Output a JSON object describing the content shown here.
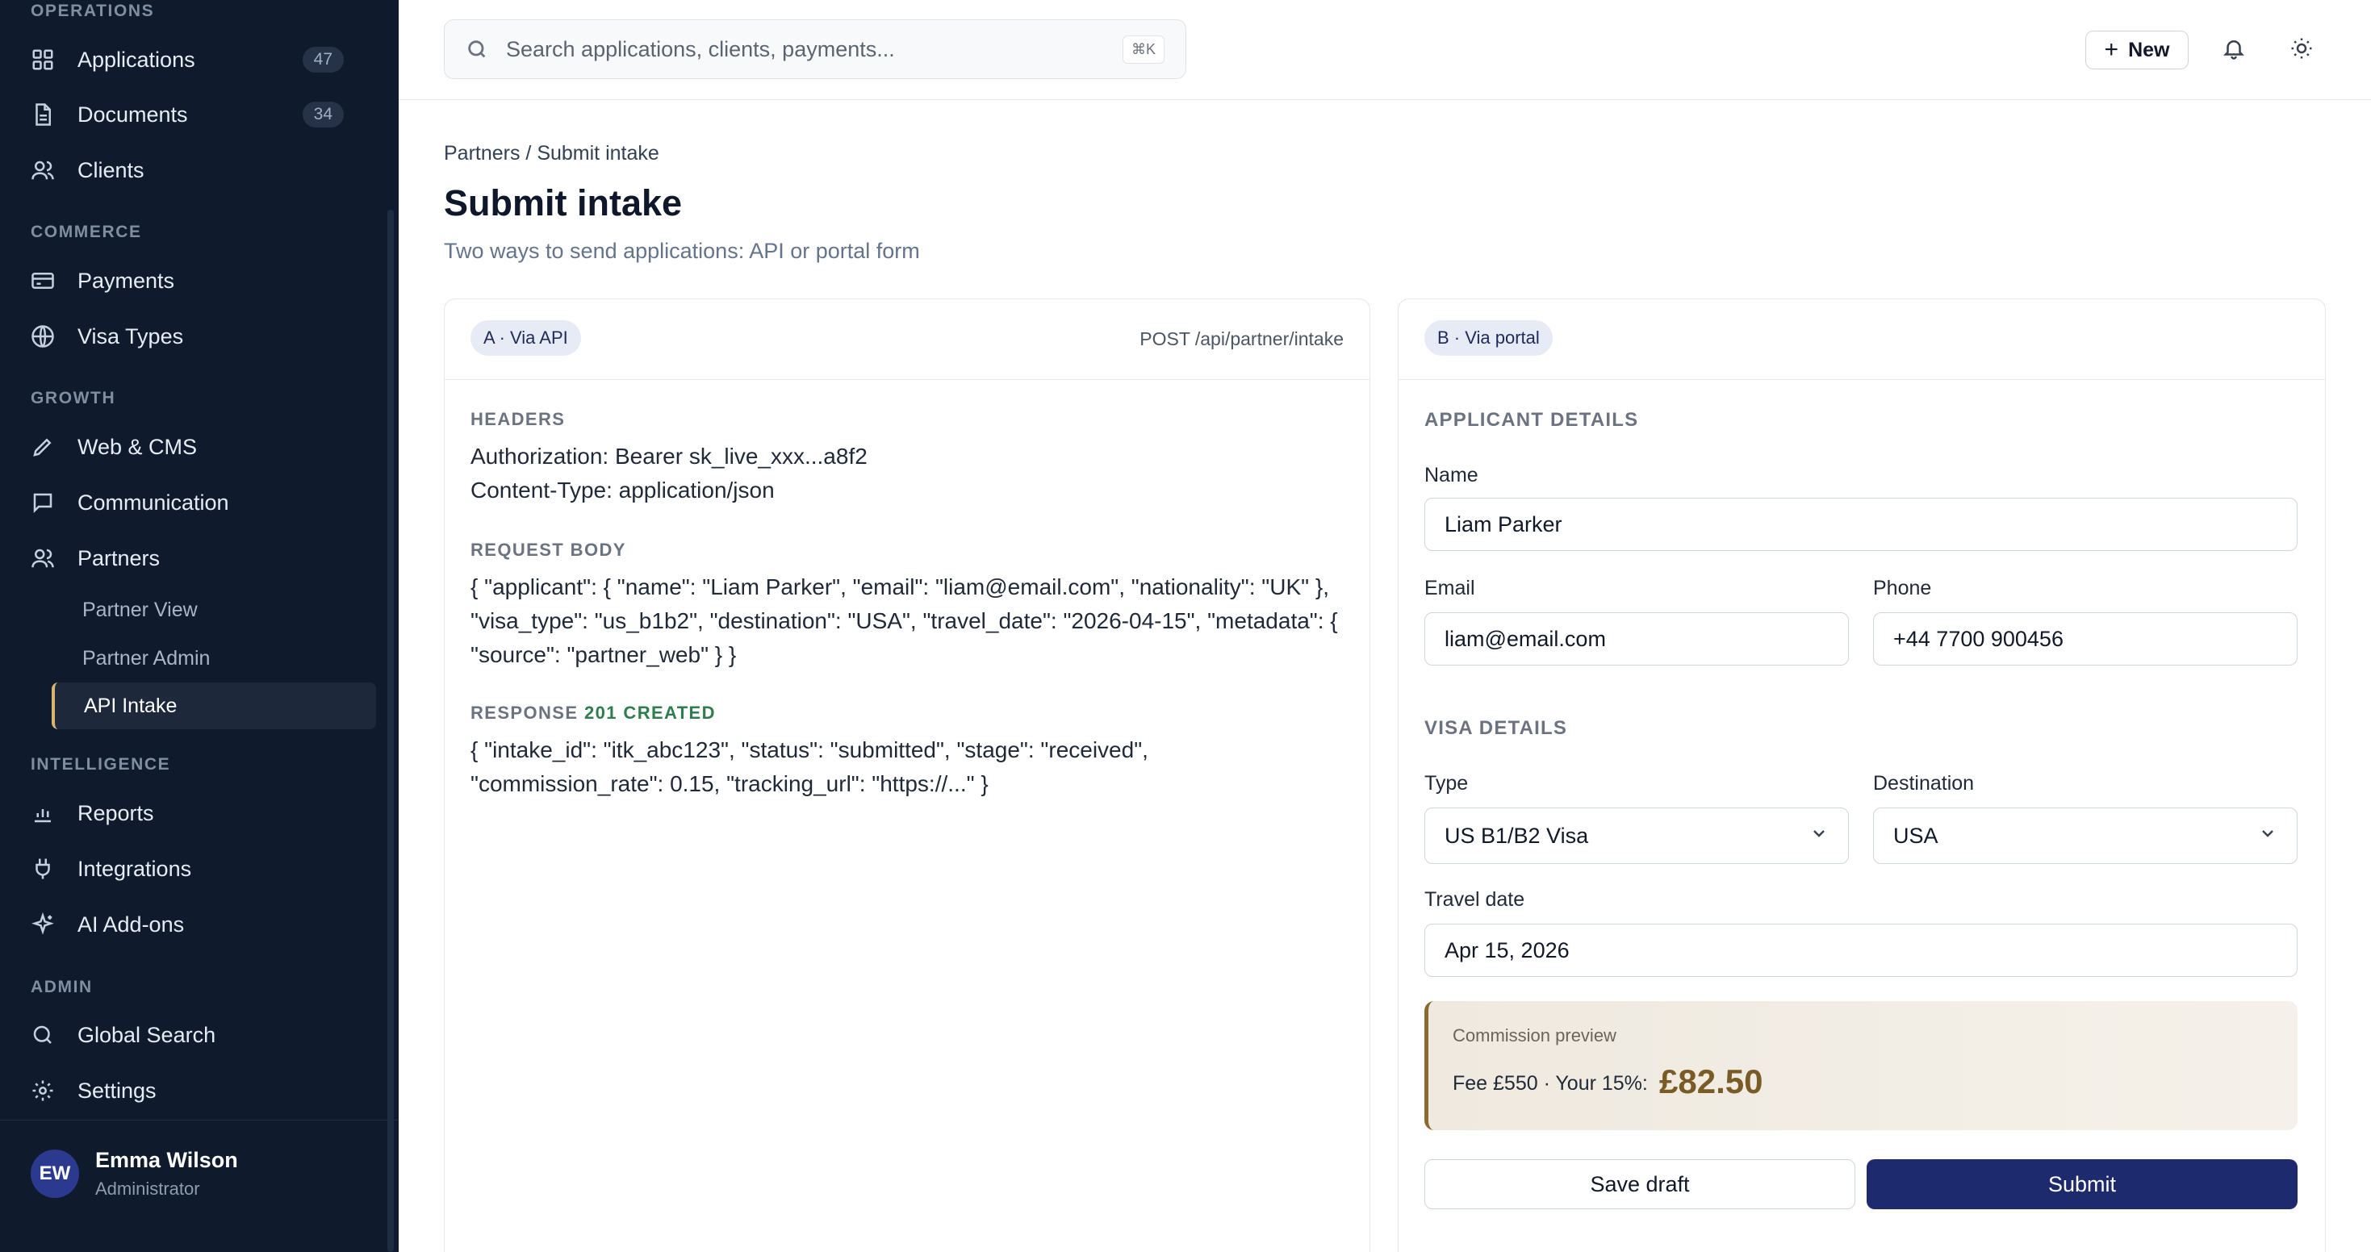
{
  "sidebar": {
    "sections": {
      "operations": "OPERATIONS",
      "commerce": "COMMERCE",
      "growth": "GROWTH",
      "intelligence": "INTELLIGENCE",
      "admin": "ADMIN"
    },
    "items": {
      "applications": {
        "label": "Applications",
        "count": "47",
        "icon": "grid-icon"
      },
      "documents": {
        "label": "Documents",
        "count": "34",
        "icon": "document-icon"
      },
      "clients": {
        "label": "Clients",
        "icon": "users-icon"
      },
      "payments": {
        "label": "Payments",
        "icon": "credit-card-icon"
      },
      "visa_types": {
        "label": "Visa Types",
        "icon": "globe-icon"
      },
      "web_cms": {
        "label": "Web & CMS",
        "icon": "pencil-icon"
      },
      "communication": {
        "label": "Communication",
        "icon": "chat-icon"
      },
      "partners": {
        "label": "Partners",
        "icon": "users-icon"
      },
      "reports": {
        "label": "Reports",
        "icon": "bar-chart-icon"
      },
      "integrations": {
        "label": "Integrations",
        "icon": "plug-icon"
      },
      "ai_addons": {
        "label": "AI Add-ons",
        "icon": "sparkle-icon"
      },
      "global_search": {
        "label": "Global Search",
        "icon": "search-icon"
      },
      "settings": {
        "label": "Settings",
        "icon": "gear-icon"
      }
    },
    "sub_items": {
      "partner_view": "Partner View",
      "partner_admin": "Partner Admin",
      "api_intake": "API Intake"
    },
    "user": {
      "initials": "EW",
      "name": "Emma Wilson",
      "role": "Administrator"
    }
  },
  "topbar": {
    "search_placeholder": "Search applications, clients, payments...",
    "shortcut": "⌘K",
    "new_label": "New"
  },
  "page": {
    "breadcrumb": "Partners / Submit intake",
    "title": "Submit intake",
    "subtitle": "Two ways to send applications: API or portal form"
  },
  "api_card": {
    "badge": "A · Via API",
    "endpoint": "POST /api/partner/intake",
    "headers_label": "HEADERS",
    "headers_line1": "Authorization: Bearer sk_live_xxx...a8f2",
    "headers_line2": "Content-Type: application/json",
    "request_label": "REQUEST BODY",
    "request_body": "{ \"applicant\": { \"name\": \"Liam Parker\", \"email\": \"liam@email.com\", \"nationality\": \"UK\" }, \"visa_type\": \"us_b1b2\", \"destination\": \"USA\", \"travel_date\": \"2026-04-15\", \"metadata\": { \"source\": \"partner_web\" } }",
    "response_label": "RESPONSE",
    "response_status": "201 CREATED",
    "response_body": "{ \"intake_id\": \"itk_abc123\", \"status\": \"submitted\", \"stage\": \"received\", \"commission_rate\": 0.15, \"tracking_url\": \"https://...\" }"
  },
  "portal_card": {
    "badge": "B · Via portal",
    "applicant_section": "APPLICANT DETAILS",
    "name_label": "Name",
    "name_value": "Liam Parker",
    "email_label": "Email",
    "email_value": "liam@email.com",
    "phone_label": "Phone",
    "phone_value": "+44 7700 900456",
    "visa_section": "VISA DETAILS",
    "type_label": "Type",
    "type_value": "US B1/B2 Visa",
    "destination_label": "Destination",
    "destination_value": "USA",
    "travel_label": "Travel date",
    "travel_value": "Apr 15, 2026",
    "commission_label": "Commission preview",
    "commission_fee": "Fee £550 · Your 15%:",
    "commission_amount": "£82.50",
    "save_draft": "Save draft",
    "submit": "Submit"
  },
  "colors": {
    "sidebar_bg": "#0f1b2d",
    "accent_primary": "#1e2a6e",
    "active_marker": "#d9b46b",
    "commission_accent": "#7a5a25",
    "success": "#2e7d4f"
  }
}
